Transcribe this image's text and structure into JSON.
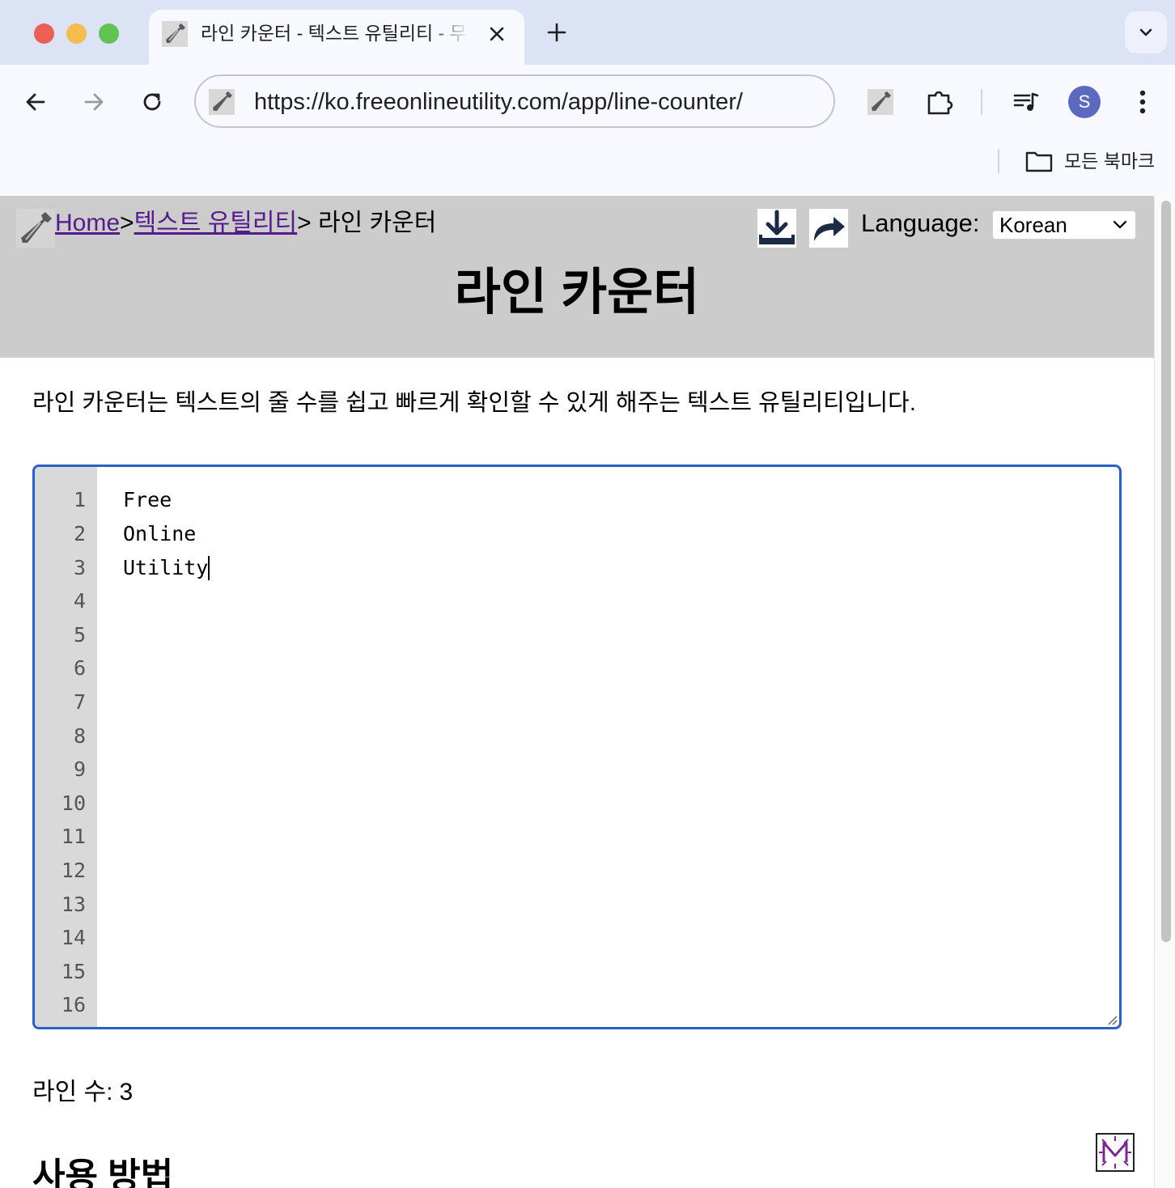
{
  "browser": {
    "tab_title": "라인 카운터 - 텍스트 유틸리티 - 무료 온라인 유틸리티",
    "url": "https://ko.freeonlineutility.com/app/line-counter/",
    "profile_initial": "S",
    "bookmarks_label": "모든 북마크",
    "icons": [
      "back-arrow-icon",
      "forward-arrow-icon",
      "reload-icon",
      "extension-puzzle-icon",
      "media-control-icon",
      "more-vertical-icon",
      "folder-icon",
      "close-icon",
      "plus-icon",
      "chevron-down-icon"
    ]
  },
  "header": {
    "breadcrumb": {
      "home": "Home",
      "sep1": ">",
      "category": "텍스트 유틸리티",
      "sep2": "> ",
      "current": "라인 카운터"
    },
    "language_label": "Language:",
    "language_value": "Korean",
    "title": "라인 카운터"
  },
  "main": {
    "intro": "라인 카운터는 텍스트의 줄 수를 쉽고 빠르게 확인할 수 있게 해주는 텍스트 유틸리티입니다.",
    "editor": {
      "line_numbers": [
        "1",
        "2",
        "3",
        "4",
        "5",
        "6",
        "7",
        "8",
        "9",
        "10",
        "11",
        "12",
        "13",
        "14",
        "15",
        "16"
      ],
      "lines": [
        "Free",
        "Online",
        "Utility"
      ]
    },
    "count_label": "라인 수:",
    "count_value": "3",
    "section_heading": "사용 방법"
  },
  "colors": {
    "header_bg": "#cccccc",
    "editor_border": "#2b61c0",
    "link_visited": "#551a8b",
    "avatar": "#5b6abf"
  }
}
